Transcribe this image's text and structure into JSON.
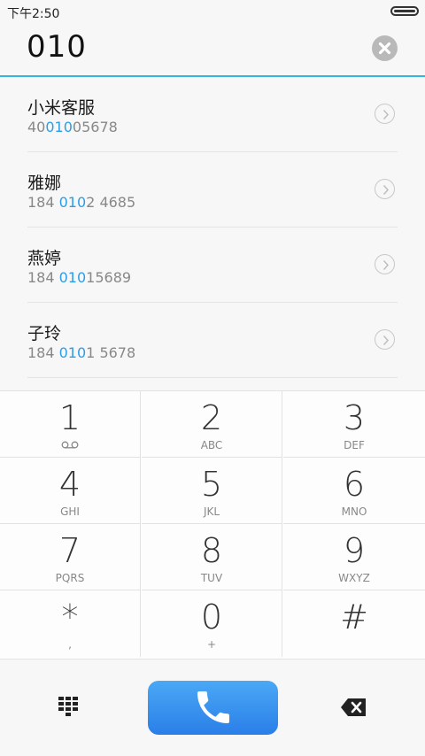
{
  "status": {
    "time": "下午2:50"
  },
  "input": {
    "number": "010"
  },
  "results": [
    {
      "name": "小米客服",
      "number_pre": "40",
      "number_match": "010",
      "number_post": "05678"
    },
    {
      "name": "雅娜",
      "number_pre": "184 ",
      "number_match": "010",
      "number_post": "2 4685"
    },
    {
      "name": "燕婷",
      "number_pre": "184 ",
      "number_match": "010",
      "number_post": "15689"
    },
    {
      "name": "子玲",
      "number_pre": "184 ",
      "number_match": "010",
      "number_post": "1 5678"
    }
  ],
  "keypad": {
    "k1": {
      "digit": "1",
      "letters": ""
    },
    "k2": {
      "digit": "2",
      "letters": "ABC"
    },
    "k3": {
      "digit": "3",
      "letters": "DEF"
    },
    "k4": {
      "digit": "4",
      "letters": "GHI"
    },
    "k5": {
      "digit": "5",
      "letters": "JKL"
    },
    "k6": {
      "digit": "6",
      "letters": "MNO"
    },
    "k7": {
      "digit": "7",
      "letters": "PQRS"
    },
    "k8": {
      "digit": "8",
      "letters": "TUV"
    },
    "k9": {
      "digit": "9",
      "letters": "WXYZ"
    },
    "kstar": {
      "digit": "*",
      "letters": ","
    },
    "k0": {
      "digit": "0",
      "letters": "+"
    },
    "khash": {
      "digit": "#",
      "letters": ""
    }
  },
  "colors": {
    "accent": "#33b7e0",
    "match_highlight": "#2a9ee8",
    "call_button": "#2a7fe8"
  },
  "icons": {
    "battery": "battery-icon",
    "clear": "clear-icon",
    "arrow": "chevron-right-icon",
    "voicemail": "voicemail-icon",
    "dialpad": "dialpad-icon",
    "call": "phone-icon",
    "backspace": "backspace-icon"
  }
}
